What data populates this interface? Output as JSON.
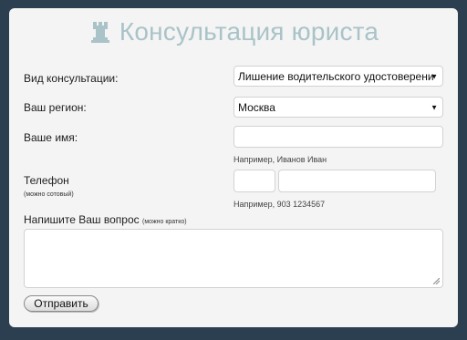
{
  "form": {
    "title": "Консультация юриста",
    "consult_type_label": "Вид консультации:",
    "consult_type_value": "Лишение водительского удостоверени",
    "region_label": "Ваш регион:",
    "region_value": "Москва",
    "name_label": "Ваше имя:",
    "name_value": "",
    "name_hint": "Например, Иванов Иван",
    "phone_label": "Телефон",
    "phone_sublabel": "(можно сотовый)",
    "phone_code_value": "",
    "phone_number_value": "",
    "phone_hint": "Например, 903 1234567",
    "question_label": "Напишите Ваш вопрос",
    "question_sublabel": "(можно кратко)",
    "question_value": "",
    "submit_label": "Отправить"
  },
  "icons": {
    "title_icon": "rook-icon",
    "select_arrow": "triangle-down-icon"
  },
  "colors": {
    "background": "#2b3f51",
    "card": "#f4f4f4",
    "title": "#a9c3c8"
  }
}
